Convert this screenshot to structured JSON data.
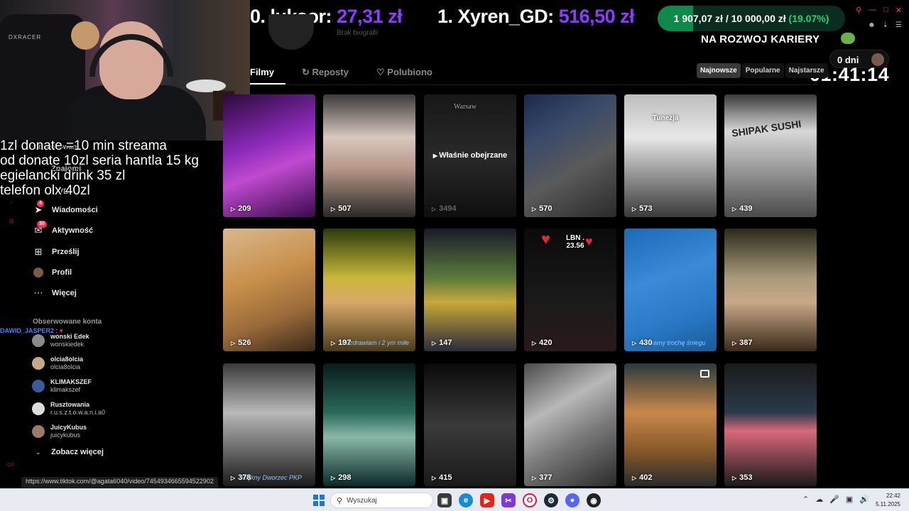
{
  "stream": {
    "donor2": {
      "rank_name": "0. luksor:",
      "amount": "27,31 zł"
    },
    "donor1": {
      "rank_name": "1. Xyren_GD:",
      "amount": "516,50 zł"
    },
    "goal": {
      "current": "1 907,07 zł",
      "separator": "/",
      "target": "10 000,00 zł",
      "percent": "(19.07%)",
      "fraction": 0.1907,
      "name": "NA ROZWOJ KARIERY"
    },
    "days": "0 dni",
    "timer": "01:41:14",
    "donation_overlay": [
      "1zl donate =10 min streama",
      "od donate 10zl seria hantla 15 kg",
      "egielancki drink 35 zl",
      "telefon olx 40zl"
    ],
    "chat": {
      "user": "DAWID_JASPER2",
      "separator": ":"
    }
  },
  "profile": {
    "subtitle": "Brak biografii"
  },
  "tabs": [
    {
      "label": "Filmy",
      "active": true
    },
    {
      "label": "Reposty",
      "active": false
    },
    {
      "label": "Polubiono",
      "active": false
    }
  ],
  "sort": [
    "Najnowsze",
    "Popularne",
    "Najstarsze"
  ],
  "sidebar": {
    "obscured": [
      "Obserwowani",
      "Znajomi",
      "LIVE"
    ],
    "nav": [
      {
        "label": "Wiadomości",
        "icon": "send-icon",
        "badge": "4"
      },
      {
        "label": "Aktywność",
        "icon": "inbox-icon",
        "badge": "30"
      },
      {
        "label": "Prześlij",
        "icon": "upload-icon",
        "badge": ""
      },
      {
        "label": "Profil",
        "icon": "avatar",
        "badge": ""
      },
      {
        "label": "Więcej",
        "icon": "more-icon",
        "badge": ""
      }
    ],
    "followed_heading": "Obserwowane konta",
    "accounts": [
      {
        "name": "wonski Edek",
        "handle": "wonskiedek",
        "color": "#8a8a8a"
      },
      {
        "name": "olcia8olcia",
        "handle": "olcia8olcia",
        "color": "#c8a68a"
      },
      {
        "name": "KLIMAKSZEF",
        "handle": "klimakszef",
        "color": "#3a5a9a"
      },
      {
        "name": "Rusztowania",
        "handle": "r.u.s.z.t.o.w.a.n.i.a0",
        "color": "#ddd"
      },
      {
        "name": "JuicyKubus",
        "handle": "juicykubus",
        "color": "#9a7a6a"
      }
    ],
    "see_more": "Zobacz więcej",
    "rail_label": "GX"
  },
  "videos": [
    {
      "views": "209",
      "bg": "linear-gradient(160deg,#2a0a3a 0%,#8a2ab8 40%,#c04ad0 60%,#3a0a4a 100%)"
    },
    {
      "views": "507",
      "bg": "linear-gradient(180deg,#3a3a3a 0%,#d8c8c0 35%,#b89888 60%,#2a2a2a 100%)"
    },
    {
      "views": "3494",
      "bg": "linear-gradient(180deg,#2a2a2a 0%,#4a4a4a 50%,#1a1a1a 100%)",
      "watched": "Właśnie obejrzane",
      "overlay": "Warsaw"
    },
    {
      "views": "570",
      "bg": "linear-gradient(150deg,#1a2a4a 0%,#3a4a6a 30%,#5a5a5a 60%,#2a2a2a 100%)"
    },
    {
      "views": "573",
      "bg": "linear-gradient(180deg,#bcbcbc 0%,#e8e8e8 35%,#888 70%,#3a3a3a 100%)",
      "overlay": "Tunezja"
    },
    {
      "views": "439",
      "bg": "linear-gradient(180deg,#3a3a3a 0%,#d8d8d8 30%,#9a9a9a 60%,#4a4a4a 100%)",
      "overlay": "SHIPAK SUSHI"
    },
    {
      "views": "526",
      "bg": "linear-gradient(160deg,#d8b890 0%,#c8904a 40%,#9a6a3a 70%,#3a2a1a 100%)"
    },
    {
      "views": "197",
      "bg": "linear-gradient(180deg,#2a3a0a 0%,#c8b83a 40%,#d8a868 60%,#4a3a1a 100%)",
      "caption": "Pozdrawiam i 2 ym miłe"
    },
    {
      "views": "147",
      "bg": "linear-gradient(180deg,#1a1a2a 0%,#5a7a3a 40%,#c8a83a 60%,#2a2a3a 100%)"
    },
    {
      "views": "420",
      "bg": "linear-gradient(180deg,#0a0a0a 0%,#1a1a1a 60%,#2a1a1a 100%)",
      "overlay": "LBN . 23.56"
    },
    {
      "views": "430",
      "bg": "linear-gradient(160deg,#1a6ab8 0%,#3a8ad8 40%,#2a7ac8 70%,#1a5a98 100%)",
      "caption": "u mamy trochę śniegu"
    },
    {
      "views": "387",
      "bg": "linear-gradient(180deg,#2a2a1a 0%,#a89a7a 40%,#c8a888 60%,#3a2a1a 100%)"
    },
    {
      "views": "378",
      "bg": "linear-gradient(180deg,#3a3a3a 0%,#b8b8b8 40%,#6a6a6a 70%,#1a1a1a 100%)",
      "caption": "Piękny Dworzec PKP"
    },
    {
      "views": "298",
      "bg": "linear-gradient(180deg,#0a1a1a 0%,#2a6a5a 40%,#8ab8a8 60%,#0a2a2a 100%)"
    },
    {
      "views": "415",
      "bg": "linear-gradient(180deg,#0a0a0a 0%,#3a3a3a 50%,#1a1a1a 100%)"
    },
    {
      "views": "377",
      "bg": "linear-gradient(150deg,#4a4a4a 0%,#b8b8b8 35%,#7a7a7a 60%,#2a2a2a 100%)"
    },
    {
      "views": "402",
      "bg": "linear-gradient(180deg,#2a3a3a 0%,#c8884a 40%,#8a5a2a 70%,#2a2a2a 100%)",
      "photo": true
    },
    {
      "views": "353",
      "bg": "linear-gradient(180deg,#1a1a1a 0%,#2a3a4a 40%,#d86a7a 55%,#1a1a1a 100%)"
    }
  ],
  "status_url": "https://www.tiktok.com/@agata6040/video/7454934665594522902",
  "taskbar": {
    "search_placeholder": "Wyszukaj",
    "time": "22:42",
    "date": "5.11.2025"
  }
}
